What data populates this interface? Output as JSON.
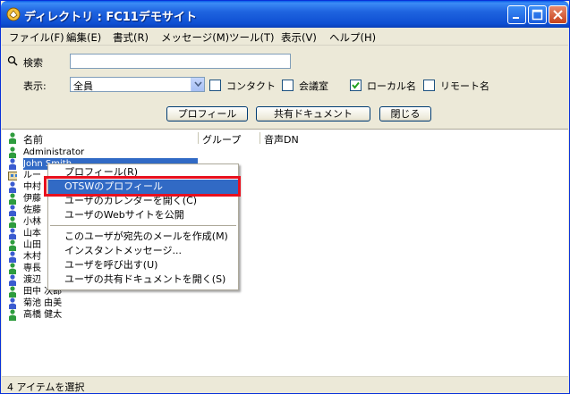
{
  "window": {
    "title": "ディレクトリ : FC11デモサイト"
  },
  "menubar": {
    "items": [
      "ファイル(F)",
      "編集(E)",
      "書式(R)",
      "メッセージ(M)",
      "ツール(T)",
      "表示(V)",
      "ヘルプ(H)"
    ]
  },
  "form": {
    "search_label": "検索",
    "search_value": "",
    "display_label": "表示:",
    "display_selected": "全員",
    "checkboxes": [
      {
        "label": "コンタクト",
        "checked": false
      },
      {
        "label": "会議室",
        "checked": false
      },
      {
        "label": "ローカル名",
        "checked": true
      },
      {
        "label": "リモート名",
        "checked": false
      }
    ],
    "buttons": {
      "profile": "プロフィール",
      "shared_docs": "共有ドキュメント",
      "close": "閉じる"
    }
  },
  "list": {
    "columns": [
      "名前",
      "グループ",
      "音声DN"
    ],
    "rows": [
      {
        "name": "Administrator",
        "kind": "user",
        "selected": false
      },
      {
        "name": "John Smith",
        "kind": "user",
        "selected": true
      },
      {
        "name": "ルー",
        "kind": "room",
        "selected": false
      },
      {
        "name": "中村",
        "kind": "user",
        "selected": false
      },
      {
        "name": "伊藤",
        "kind": "user",
        "selected": false
      },
      {
        "name": "佐藤",
        "kind": "user",
        "selected": false
      },
      {
        "name": "小林",
        "kind": "user",
        "selected": false
      },
      {
        "name": "山本",
        "kind": "user",
        "selected": false
      },
      {
        "name": "山田",
        "kind": "user",
        "selected": false
      },
      {
        "name": "木村",
        "kind": "user",
        "selected": false
      },
      {
        "name": "専長",
        "kind": "user",
        "selected": false
      },
      {
        "name": "渡辺",
        "kind": "user",
        "selected": false
      },
      {
        "name": "田中 次郎",
        "kind": "user",
        "selected": false
      },
      {
        "name": "菊池 由美",
        "kind": "user",
        "selected": false
      },
      {
        "name": "高橋 健太",
        "kind": "user",
        "selected": false
      }
    ]
  },
  "context_menu": {
    "items": [
      {
        "label": "プロフィール(R)",
        "highlighted": false
      },
      {
        "label": "OTSWのプロフィール",
        "highlighted": true
      },
      {
        "label": "ユーザのカレンダーを開く(C)",
        "highlighted": false
      },
      {
        "label": "ユーザのWebサイトを公開",
        "highlighted": false
      },
      {
        "label": "このユーザが宛先のメールを作成(M)",
        "highlighted": false
      },
      {
        "label": "インスタントメッセージ...",
        "highlighted": false
      },
      {
        "label": "ユーザを呼び出す(U)",
        "highlighted": false
      },
      {
        "label": "ユーザの共有ドキュメントを開く(S)",
        "highlighted": false
      }
    ]
  },
  "status": {
    "text": "4 アイテムを選択"
  },
  "colors": {
    "selection": "#316ac5",
    "highlight_box": "#e8101e",
    "titlebar": "#0e4fd2"
  }
}
